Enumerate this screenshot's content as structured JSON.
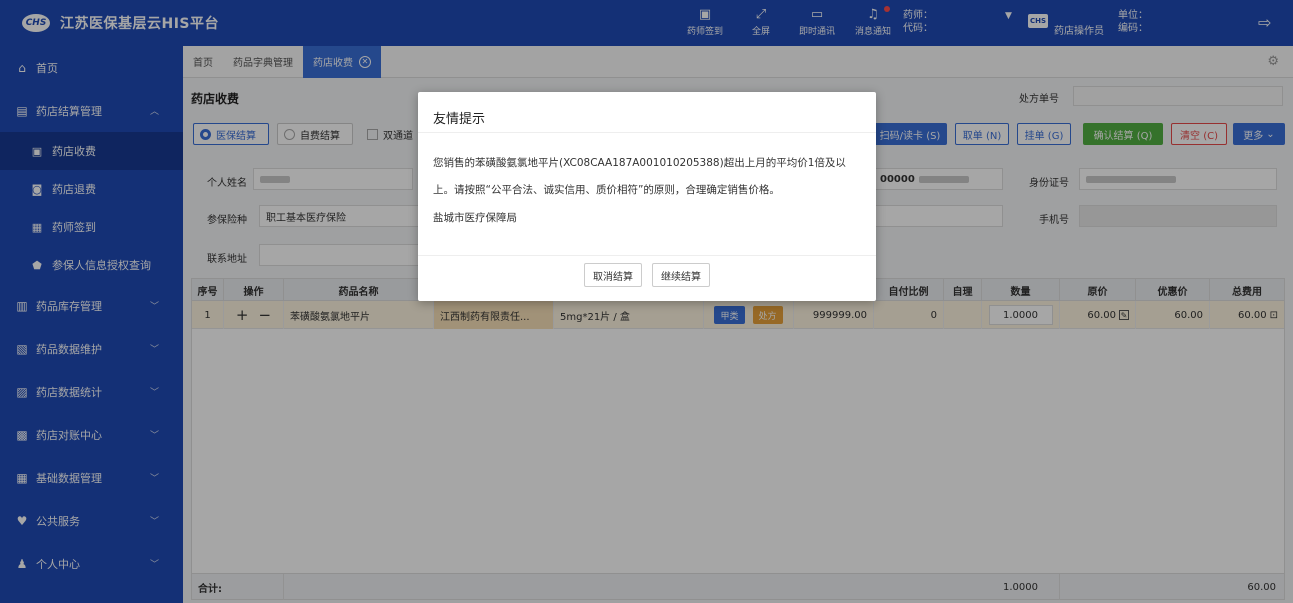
{
  "app": {
    "title": "江苏医保基层云HIS平台",
    "logo_text": "CHS"
  },
  "header": {
    "tools": [
      {
        "icon": "calendar-check-icon",
        "glyph": "▣",
        "label": "药师签到",
        "dot": false
      },
      {
        "icon": "fullscreen-icon",
        "glyph": "⤢",
        "label": "全屏",
        "dot": false
      },
      {
        "icon": "chat-icon",
        "glyph": "▭",
        "label": "即时通讯",
        "dot": false
      },
      {
        "icon": "bell-icon",
        "glyph": "♫",
        "label": "消息通知",
        "dot": true
      }
    ],
    "pharmacist_label": "药师：",
    "code_label": "代码：",
    "operator_badge": "CHS",
    "operator": "药店操作员",
    "unit_label": "单位：",
    "number_label": "编码："
  },
  "sidebar": {
    "items": [
      {
        "icon": "home-icon",
        "glyph": "⌂",
        "label": "首页",
        "chevron": false
      },
      {
        "icon": "settlement-icon",
        "glyph": "▤",
        "label": "药店结算管理",
        "chevron": "up"
      },
      {
        "icon": "cashier-icon",
        "glyph": "▣",
        "label": "药店收费",
        "sub": true,
        "active": true
      },
      {
        "icon": "refund-icon",
        "glyph": "◙",
        "label": "药店退费",
        "sub": true
      },
      {
        "icon": "signin-icon",
        "glyph": "▦",
        "label": "药师签到",
        "sub": true
      },
      {
        "icon": "shield-icon",
        "glyph": "⬟",
        "label": "参保人信息授权查询",
        "sub": true
      },
      {
        "icon": "inventory-icon",
        "glyph": "▥",
        "label": "药品库存管理",
        "chevron": "down"
      },
      {
        "icon": "maintenance-icon",
        "glyph": "▧",
        "label": "药品数据维护",
        "chevron": "down"
      },
      {
        "icon": "stats-icon",
        "glyph": "▨",
        "label": "药店数据统计",
        "chevron": "down"
      },
      {
        "icon": "reconcile-icon",
        "glyph": "▩",
        "label": "药店对账中心",
        "chevron": "down"
      },
      {
        "icon": "database-icon",
        "glyph": "▦",
        "label": "基础数据管理",
        "chevron": "down"
      },
      {
        "icon": "heart-icon",
        "glyph": "♥",
        "label": "公共服务",
        "chevron": "down"
      },
      {
        "icon": "user-icon",
        "glyph": "♟",
        "label": "个人中心",
        "chevron": "down"
      }
    ]
  },
  "tabs": [
    {
      "label": "首页",
      "active": false
    },
    {
      "label": "药品字典管理",
      "active": false
    },
    {
      "label": "药店收费",
      "active": true
    }
  ],
  "page": {
    "title": "药店收费",
    "rx_label": "处方单号",
    "settle_options": [
      {
        "label": "医保结算",
        "selected": true
      },
      {
        "label": "自费结算",
        "selected": false
      }
    ],
    "dual_channel": "双通道",
    "actions": [
      {
        "label": "扫码/读卡 (S)",
        "style": "blue"
      },
      {
        "label": "取单 (N)",
        "style": "outline"
      },
      {
        "label": "挂单 (G)",
        "style": "outline"
      },
      {
        "label": "确认结算 (Q)",
        "style": "green"
      },
      {
        "label": "清空 (C)",
        "style": "red"
      },
      {
        "label": "更多",
        "style": "blue"
      }
    ],
    "fields": {
      "name_label": "个人姓名",
      "insurance_label": "参保险种",
      "insurance_value": "职工基本医疗保险",
      "address_label": "联系地址",
      "id_label": "身份证号",
      "phone_label": "手机号",
      "card_prefix": "00000"
    }
  },
  "table": {
    "columns": [
      "序号",
      "操作",
      "药品名称",
      "",
      "",
      "",
      "",
      "自付比例",
      "自理",
      "数量",
      "原价",
      "优惠价",
      "总费用"
    ],
    "rows": [
      {
        "index": "1",
        "plus": "+",
        "minus": "−",
        "drug": "苯磺酸氨氯地平片",
        "maker": "江西制药有限责任...",
        "spec": "5mg*21片 / 盒",
        "tag1": "甲类",
        "tag2": "处方",
        "limit": "999999.00",
        "self_ratio": "0",
        "qty": "1.0000",
        "price": "60.00",
        "discount": "60.00",
        "total": "60.00"
      }
    ],
    "footer": {
      "label": "合计:",
      "qty": "1.0000",
      "total": "60.00"
    }
  },
  "dialog": {
    "title": "友情提示",
    "message": "您销售的苯磺酸氨氯地平片(XC08CAA187A001010205388)超出上月的平均价1倍及以上。请按照“公平合法、诚实信用、质价相符”的原则，合理确定销售价格。",
    "org": "盐城市医疗保障局",
    "cancel": "取消结算",
    "continue": "继续结算"
  },
  "colors": {
    "brand": "#1f4ab6",
    "accent": "#3a6fd8",
    "green": "#52b043",
    "red": "#e84b4b",
    "row_highlight": "#fdf5e1"
  }
}
